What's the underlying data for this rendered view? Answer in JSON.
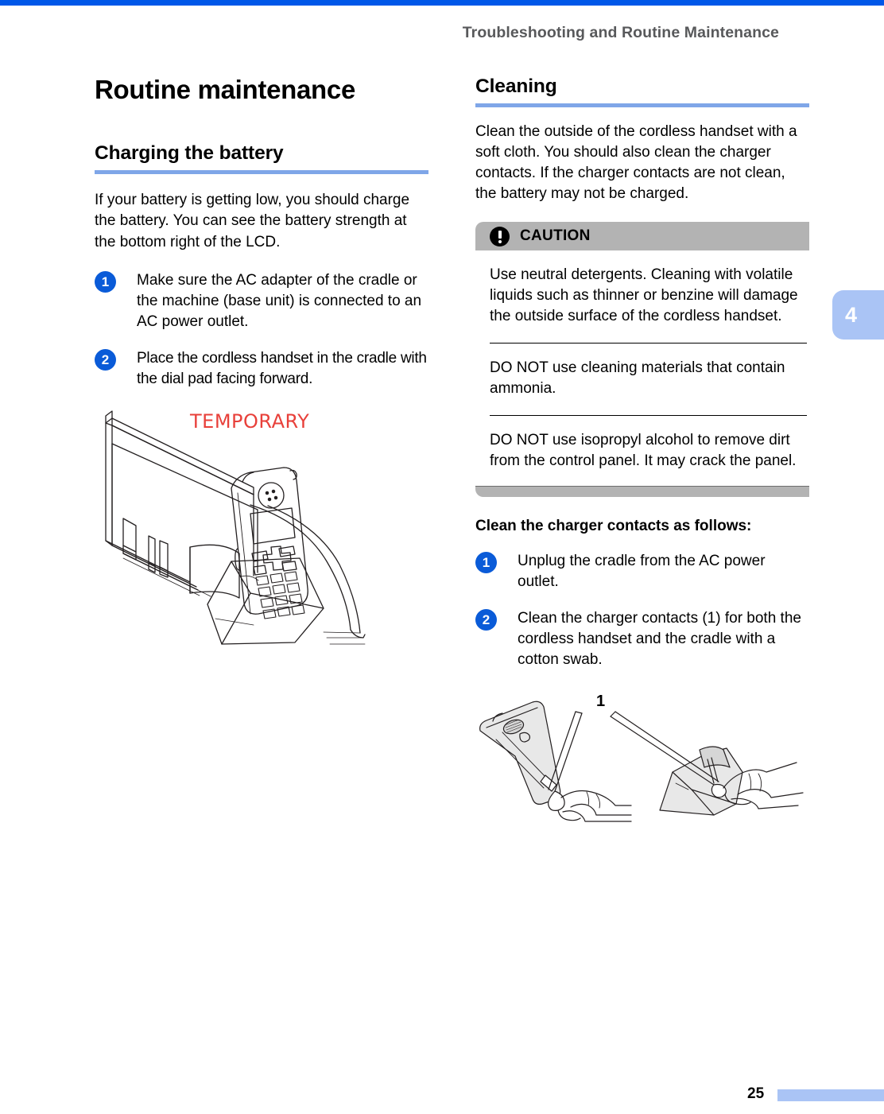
{
  "document": {
    "running_header": "Troubleshooting and Routine Maintenance",
    "chapter_tab": "4",
    "page_number": "25",
    "accent_blue": "#7FA6E8",
    "tab_blue": "#AAC4F5",
    "top_rule_blue": "#0057E8",
    "caution_gray": "#B3B3B3",
    "step_badge_blue": "#0A5BD8",
    "watermark_red": "#E8403A"
  },
  "left_column": {
    "title": "Routine maintenance",
    "section": {
      "heading": "Charging the battery",
      "intro": "If your battery is getting low, you should charge the battery. You can see the battery strength at the bottom right of the LCD.",
      "steps": [
        {
          "number": "1",
          "text": "Make sure the AC adapter of the cradle or the machine (base unit) is connected to an AC power outlet."
        },
        {
          "number": "2",
          "text": "Place the cordless handset in the cradle with the dial pad facing forward."
        }
      ],
      "figure": {
        "name": "cordless-handset-in-cradle-illustration",
        "watermark": "TEMPORARY"
      }
    }
  },
  "right_column": {
    "section": {
      "heading": "Cleaning",
      "intro": "Clean the outside of the cordless handset with a soft cloth. You should also clean the charger contacts. If the charger contacts are not clean, the battery may not be charged.",
      "caution": {
        "icon": "exclamation-circle-icon",
        "label": "CAUTION",
        "paragraphs": [
          "Use neutral detergents. Cleaning with volatile liquids such as thinner or benzine will damage the outside surface of the cordless handset.",
          "DO NOT use cleaning materials that contain ammonia.",
          "DO NOT use isopropyl alcohol to remove dirt from the control panel. It may crack the panel."
        ]
      },
      "subhead": "Clean the charger contacts as follows:",
      "steps": [
        {
          "number": "1",
          "text": "Unplug the cradle from the AC power outlet."
        },
        {
          "number": "2",
          "text": "Clean the charger contacts (1) for both the cordless handset and the cradle with a cotton swab."
        }
      ],
      "figure": {
        "name": "cleaning-charger-contacts-illustration",
        "callout": "1"
      }
    }
  }
}
